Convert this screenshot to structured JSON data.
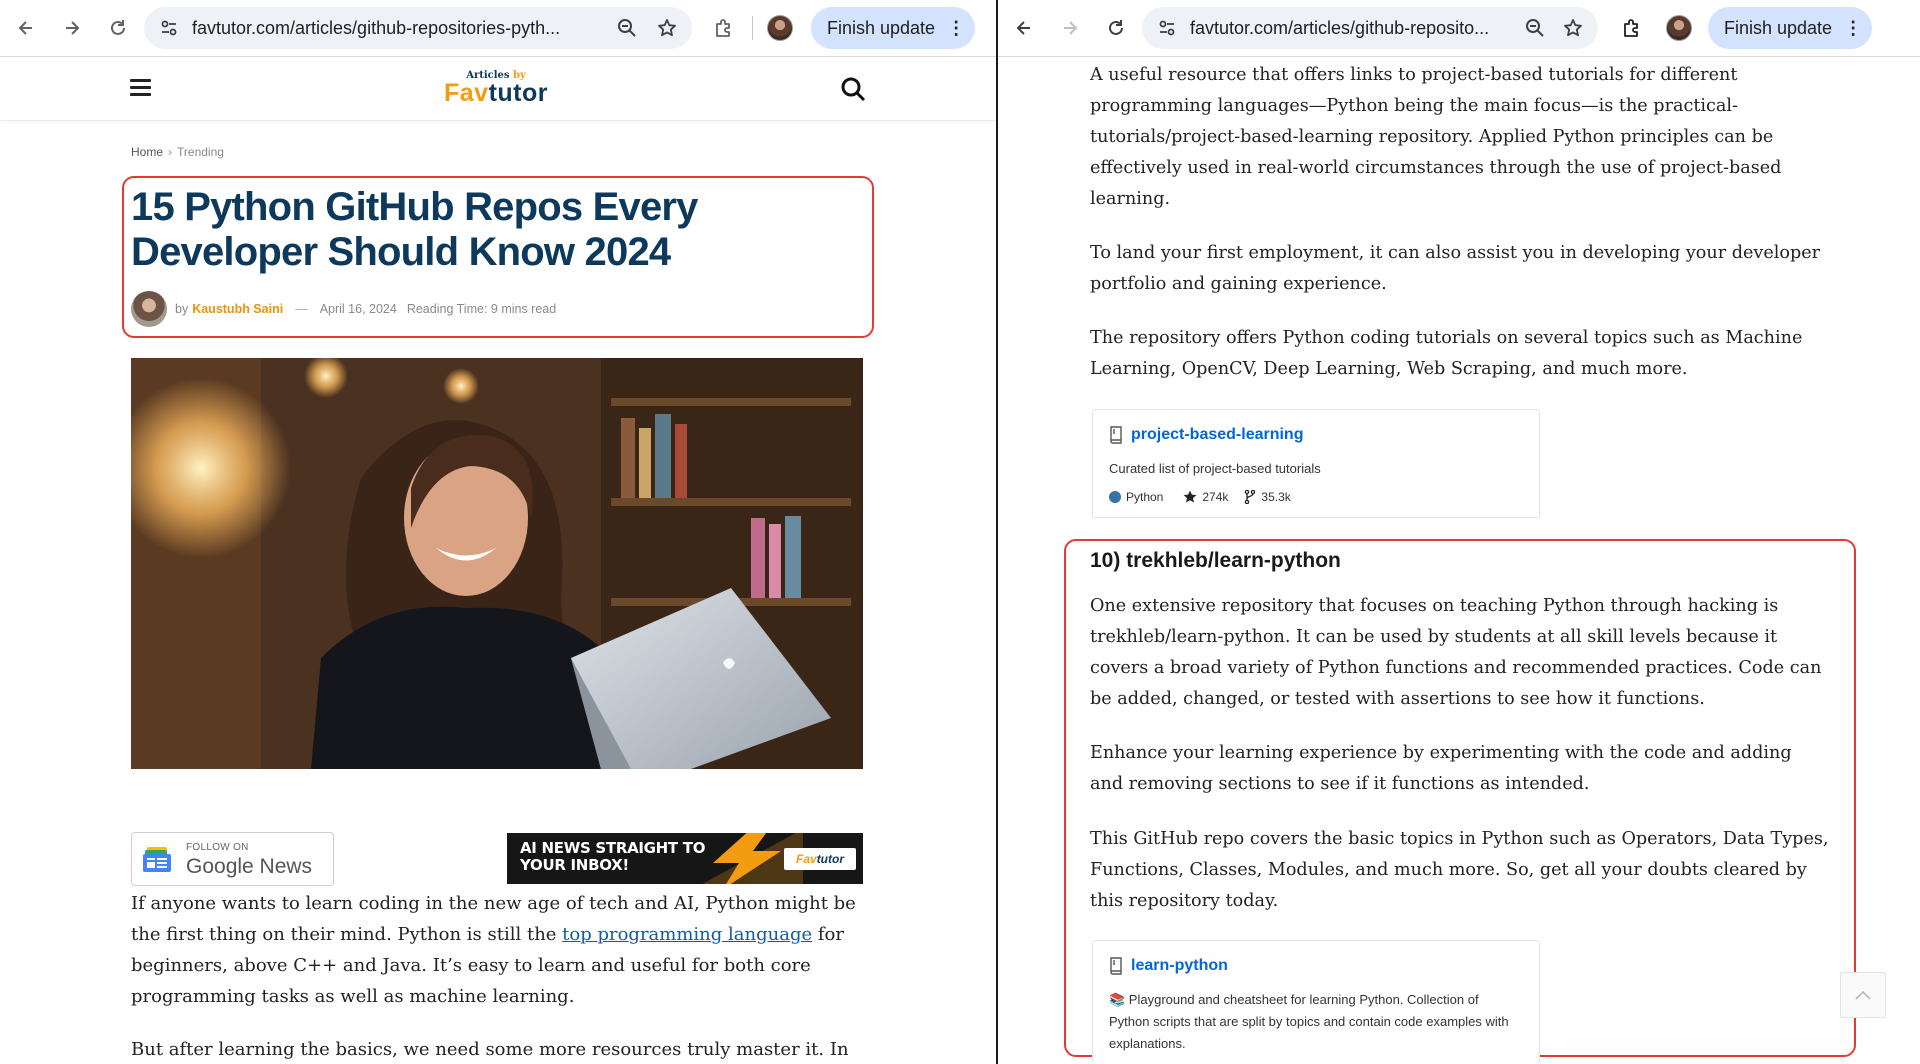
{
  "left_window": {
    "url": "favtutor.com/articles/github-repositories-pyth...",
    "finish_update": "Finish update",
    "site": {
      "logo_small_prefix": "Articles",
      "logo_small_by": "by",
      "logo_fa": "Fa",
      "logo_v": "v",
      "logo_rest": "tutor"
    },
    "breadcrumb": {
      "home": "Home",
      "sep": "›",
      "current": "Trending"
    },
    "article": {
      "title": "15 Python GitHub Repos Every Developer Should Know 2024",
      "by": "by",
      "author": "Kaustubh Saini",
      "dash": "—",
      "date": "April 16, 2024",
      "reading_time": "Reading Time: 9 mins read"
    },
    "google_news": {
      "follow": "FOLLOW ON",
      "name": "Google News"
    },
    "banner": {
      "text": "AI NEWS STRAIGHT TO YOUR INBOX!",
      "logo_fa": "Fa",
      "logo_v": "v",
      "logo_rest": "tutor"
    },
    "paragraph1": {
      "before": "If anyone wants to learn coding in the new age of tech and AI, Python might be the first thing on their mind. Python is still the ",
      "link": "top programming language",
      "after": " for beginners, above C++ and Java. It’s easy to learn and useful for both core programming tasks as well as machine learning."
    },
    "paragraph2": "But after learning the basics, we need some more resources truly master it. In this"
  },
  "right_window": {
    "url": "favtutor.com/articles/github-reposito...",
    "finish_update": "Finish update",
    "p1": "A useful resource that offers links to project-based tutorials for different programming languages—Python being the main focus—is the practical-tutorials/project-based-learning repository. Applied Python principles can be effectively used in real-world circumstances through the use of project-based learning.",
    "p2": "To land your first employment, it can also assist you in developing your developer portfolio and gaining experience.",
    "p3": "The repository offers Python coding tutorials on several topics such as Machine Learning, OpenCV, Deep Learning, Web Scraping, and much more.",
    "card1": {
      "name": "project-based-learning",
      "desc": "Curated list of project-based tutorials",
      "language": "Python",
      "stars": "274k",
      "forks": "35.3k"
    },
    "section_heading": "10) trekhleb/learn-python",
    "p4": "One extensive repository that focuses on teaching Python through hacking is trekhleb/learn-python. It can be used by students at all skill levels because it covers a broad variety of Python functions and recommended practices. Code can be added, changed, or tested with assertions to see how it functions.",
    "p5": "Enhance your learning experience by experimenting with the code and adding and removing sections to see if it functions as intended.",
    "p6": "This GitHub repo covers the basic topics in Python such as Operators, Data Types, Functions, Classes, Modules, and much more. So, get all your doubts cleared by this repository today.",
    "card2": {
      "name": "learn-python",
      "desc": "📚 Playground and cheatsheet for learning Python. Collection of Python scripts that are split by topics and contain code examples with explanations."
    }
  },
  "colors": {
    "brand_navy": "#0d3a5c",
    "brand_orange": "#f39c12",
    "highlight_red": "#e53935",
    "link_blue": "#0366d6",
    "python_lang": "#3572a5"
  },
  "icons": [
    "back-icon",
    "forward-icon",
    "reload-icon",
    "site-info-icon",
    "zoom-icon",
    "star-icon",
    "extensions-icon",
    "profile-avatar",
    "menu-icon",
    "search-icon",
    "repo-icon",
    "fork-icon",
    "chevron-up-icon"
  ]
}
